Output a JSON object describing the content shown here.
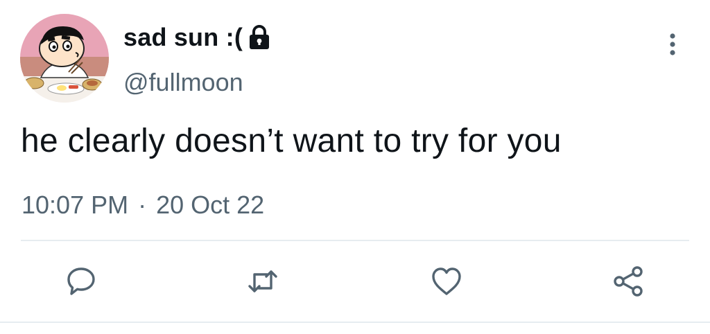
{
  "tweet": {
    "display_name": "sad sun :(",
    "handle": "@fullmoon",
    "text": "he clearly doesn’t want to try for you",
    "time": "10:07 PM",
    "separator": "·",
    "date": "20 Oct 22"
  },
  "icons": {
    "lock": "lock-icon",
    "more": "more-options-icon",
    "reply": "reply-icon",
    "retweet": "retweet-icon",
    "like": "heart-icon",
    "share": "share-icon"
  },
  "colors": {
    "text_primary": "#0f1419",
    "text_secondary": "#536471",
    "icon_gray": "#536471",
    "divider": "#e6ecf0",
    "avatar_background": "#e8a4b6"
  }
}
